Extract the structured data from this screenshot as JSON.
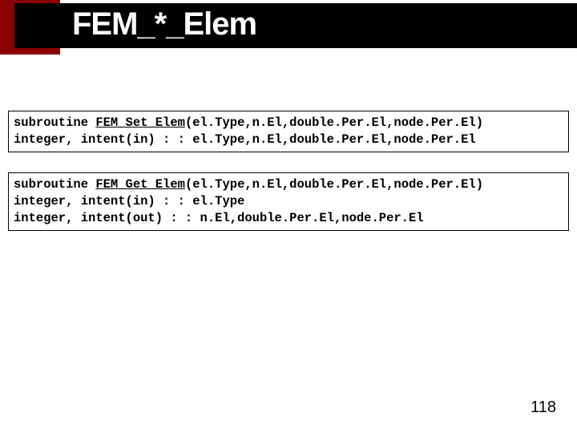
{
  "title": "FEM_*_Elem",
  "code1": {
    "kw1": "subroutine ",
    "name": "FEM_Set_Elem",
    "sig": "(el.Type,n.El,double.Per.El,node.Per.El)",
    "line2": "integer, intent(in) : : el.Type,n.El,double.Per.El,node.Per.El"
  },
  "code2": {
    "kw1": "subroutine ",
    "name": "FEM_Get_Elem",
    "sig": "(el.Type,n.El,double.Per.El,node.Per.El)",
    "line2": "integer, intent(in) : : el.Type",
    "line3": "integer, intent(out) : : n.El,double.Per.El,node.Per.El"
  },
  "page_number": "118"
}
